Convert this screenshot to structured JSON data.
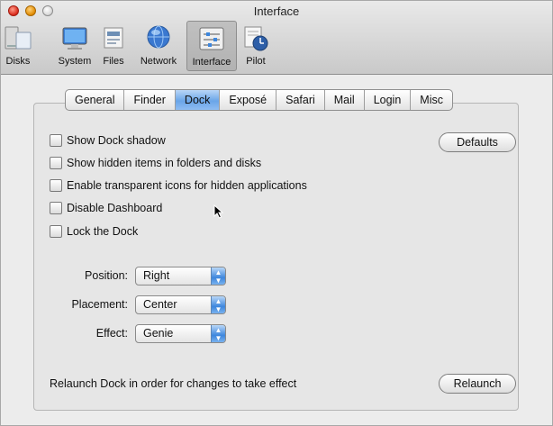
{
  "window": {
    "title": "Interface"
  },
  "toolbar": {
    "items": [
      {
        "label": "Disks",
        "icon": "disks-icon"
      },
      {
        "label": "System",
        "icon": "system-icon"
      },
      {
        "label": "Files",
        "icon": "files-icon"
      },
      {
        "label": "Network",
        "icon": "network-icon"
      },
      {
        "label": "Interface",
        "icon": "interface-icon",
        "selected": true
      },
      {
        "label": "Pilot",
        "icon": "pilot-icon"
      }
    ]
  },
  "tabs": {
    "items": [
      "General",
      "Finder",
      "Dock",
      "Exposé",
      "Safari",
      "Mail",
      "Login",
      "Misc"
    ],
    "active": "Dock"
  },
  "dock": {
    "checkboxes": [
      {
        "label": "Show Dock shadow",
        "checked": false
      },
      {
        "label": "Show hidden items in folders and disks",
        "checked": false
      },
      {
        "label": "Enable transparent icons for hidden applications",
        "checked": false
      },
      {
        "label": "Disable Dashboard",
        "checked": false
      },
      {
        "label": "Lock the Dock",
        "checked": false
      }
    ],
    "defaults_button": "Defaults",
    "position": {
      "label": "Position:",
      "value": "Right"
    },
    "placement": {
      "label": "Placement:",
      "value": "Center"
    },
    "effect": {
      "label": "Effect:",
      "value": "Genie"
    },
    "relaunch_text": "Relaunch Dock in order for changes to take effect",
    "relaunch_button": "Relaunch"
  },
  "colors": {
    "active_tab": "#6aa5e8",
    "popup_arrow": "#3d86dd"
  }
}
